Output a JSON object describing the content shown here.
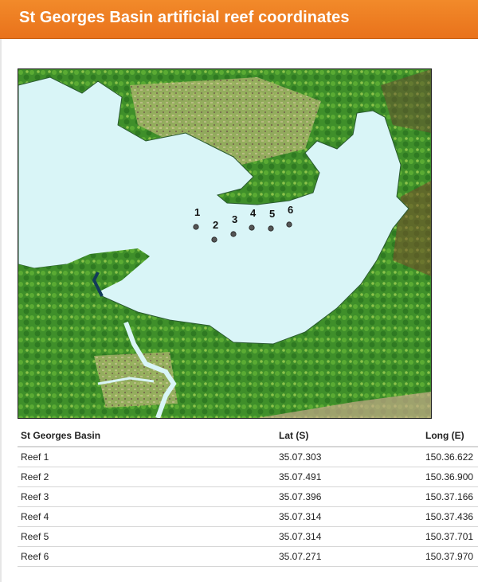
{
  "page": {
    "title": "St Georges Basin artificial reef coordinates"
  },
  "map": {
    "reef_markers": [
      {
        "label": "1"
      },
      {
        "label": "2"
      },
      {
        "label": "3"
      },
      {
        "label": "4"
      },
      {
        "label": "5"
      },
      {
        "label": "6"
      }
    ],
    "colors": {
      "water": "#d9f5f7",
      "vegetation": "#3f8f2a",
      "urban": "#b8b080",
      "marker": "#555555"
    }
  },
  "table": {
    "headers": [
      "St Georges Basin",
      "Lat (S)",
      "Long (E)"
    ],
    "rows": [
      {
        "name": "Reef 1",
        "lat": "35.07.303",
        "long": "150.36.622"
      },
      {
        "name": "Reef 2",
        "lat": "35.07.491",
        "long": "150.36.900"
      },
      {
        "name": "Reef 3",
        "lat": "35.07.396",
        "long": "150.37.166"
      },
      {
        "name": "Reef 4",
        "lat": "35.07.314",
        "long": "150.37.436"
      },
      {
        "name": "Reef 5",
        "lat": "35.07.314",
        "long": "150.37.701"
      },
      {
        "name": "Reef 6",
        "lat": "35.07.271",
        "long": "150.37.970"
      }
    ]
  }
}
